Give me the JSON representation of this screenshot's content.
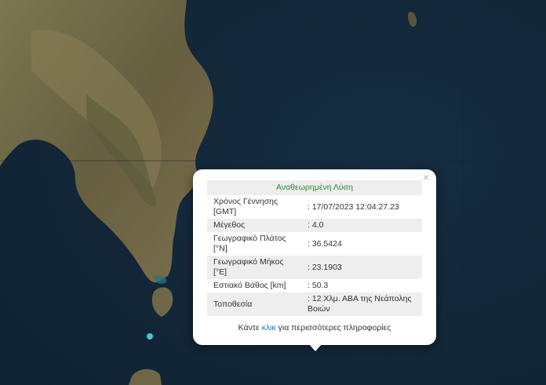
{
  "popup": {
    "title": "Αναθεωρημένη Λύση",
    "close_label": "×",
    "rows": [
      {
        "label": "Χρόνος Γέννησης [GMT]",
        "value": ": 17/07/2023 12:04:27.23"
      },
      {
        "label": "Μέγεθος",
        "value": ": 4.0"
      },
      {
        "label": "Γεωγραφικό Πλάτος [°N]",
        "value": ": 36.5424"
      },
      {
        "label": "Γεωγραφικό Μήκος [°E]",
        "value": ": 23.1903"
      },
      {
        "label": "Εστιακό Βάθος [km]",
        "value": ": 50.3"
      },
      {
        "label": "Τοποθεσία",
        "value": ": 12 Χλμ. ΑΒΑ της Νεάπολης Βοιών"
      }
    ],
    "more_prefix": "Κάντε ",
    "more_link": "κλικ",
    "more_suffix": " για περισσότερες πληροφορίες"
  },
  "colors": {
    "sea": "#13283a",
    "land": "#6b6a45",
    "title_green": "#2c8a2c",
    "link": "#1a7fb5",
    "marker": "#45c8d6"
  }
}
